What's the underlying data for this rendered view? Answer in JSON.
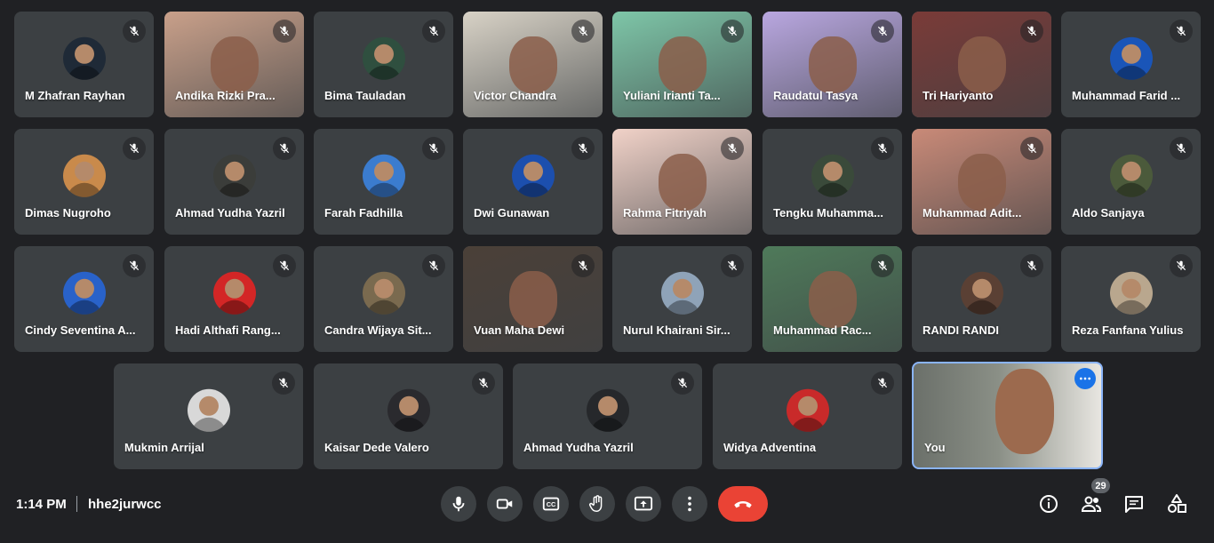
{
  "meeting": {
    "time": "1:14 PM",
    "code": "hhe2jurwcc",
    "participant_count": "29"
  },
  "participants": [
    {
      "name": "M Zhafran Rayhan",
      "mode": "avatar",
      "bg": "#1f2a37"
    },
    {
      "name": "Andika Rizki Pra...",
      "mode": "video",
      "bg": "#c9a08a"
    },
    {
      "name": "Bima Tauladan",
      "mode": "avatar",
      "bg": "#2f4f3f"
    },
    {
      "name": "Victor Chandra",
      "mode": "video",
      "bg": "#d8d2c6"
    },
    {
      "name": "Yuliani Irianti Ta...",
      "mode": "video",
      "bg": "#7ec6a8"
    },
    {
      "name": "Raudatul Tasya",
      "mode": "video",
      "bg": "#b9a7e0"
    },
    {
      "name": "Tri Hariyanto",
      "mode": "video",
      "bg": "#7a3b38"
    },
    {
      "name": "Muhammad Farid ...",
      "mode": "avatar",
      "bg": "#1a55b8"
    },
    {
      "name": "Dimas Nugroho",
      "mode": "avatar",
      "bg": "#c98a4b"
    },
    {
      "name": "Ahmad Yudha Yazril",
      "mode": "avatar",
      "bg": "#3b3d3a"
    },
    {
      "name": "Farah Fadhilla",
      "mode": "avatar",
      "bg": "#3b7ccf"
    },
    {
      "name": "Dwi Gunawan",
      "mode": "avatar",
      "bg": "#1c4fae"
    },
    {
      "name": "Rahma Fitriyah",
      "mode": "video",
      "bg": "#f1d2c8"
    },
    {
      "name": "Tengku Muhamma...",
      "mode": "avatar",
      "bg": "#3a4a3a"
    },
    {
      "name": "Muhammad Adit...",
      "mode": "video",
      "bg": "#c98a78"
    },
    {
      "name": "Aldo Sanjaya",
      "mode": "avatar",
      "bg": "#4b5a3b"
    },
    {
      "name": "Cindy Seventina A...",
      "mode": "avatar",
      "bg": "#2962c9"
    },
    {
      "name": "Hadi Althafi Rang...",
      "mode": "avatar",
      "bg": "#d32626"
    },
    {
      "name": "Candra Wijaya Sit...",
      "mode": "avatar",
      "bg": "#7a6a4f"
    },
    {
      "name": "Vuan Maha Dewi",
      "mode": "video",
      "bg": "#4b4038"
    },
    {
      "name": "Nurul Khairani Sir...",
      "mode": "avatar",
      "bg": "#8fa3b8"
    },
    {
      "name": "Muhammad Rac...",
      "mode": "video",
      "bg": "#4f7a5a"
    },
    {
      "name": "RANDI RANDI",
      "mode": "avatar",
      "bg": "#5a4034"
    },
    {
      "name": "Reza Fanfana Yulius",
      "mode": "avatar",
      "bg": "#b9a78e"
    },
    {
      "name": "Mukmin Arrijal",
      "mode": "avatar",
      "bg": "#d8d8d8"
    },
    {
      "name": "Kaisar Dede Valero",
      "mode": "avatar",
      "bg": "#2a2a2e"
    },
    {
      "name": "Ahmad Yudha Yazril",
      "mode": "avatar",
      "bg": "#26282b"
    },
    {
      "name": "Widya Adventina",
      "mode": "avatar",
      "bg": "#c92a2a"
    }
  ],
  "you": {
    "name": "You",
    "bg": "#8a8f86"
  },
  "controls": [
    {
      "name": "microphone-icon"
    },
    {
      "name": "camera-icon"
    },
    {
      "name": "captions-icon"
    },
    {
      "name": "raise-hand-icon"
    },
    {
      "name": "present-screen-icon"
    },
    {
      "name": "more-options-icon"
    }
  ],
  "right_controls": [
    {
      "name": "info-icon"
    },
    {
      "name": "people-icon"
    },
    {
      "name": "chat-icon"
    },
    {
      "name": "activities-icon"
    }
  ]
}
